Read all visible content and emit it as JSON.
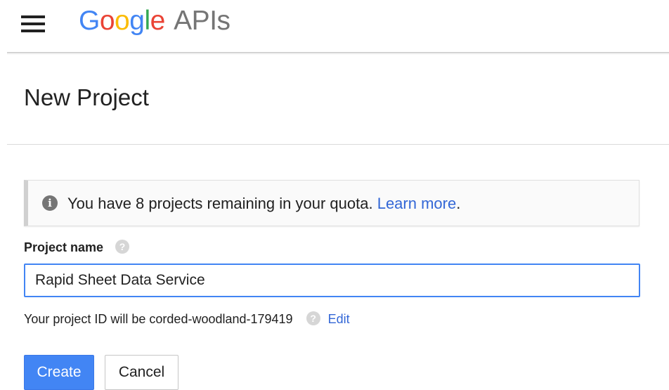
{
  "header": {
    "logo_letters": [
      {
        "char": "G",
        "color": "#4285F4"
      },
      {
        "char": "o",
        "color": "#EA4335"
      },
      {
        "char": "o",
        "color": "#FBBC05"
      },
      {
        "char": "g",
        "color": "#4285F4"
      },
      {
        "char": "l",
        "color": "#34A853"
      },
      {
        "char": "e",
        "color": "#EA4335"
      }
    ],
    "logo_suffix": "APIs",
    "menu_icon": "hamburger-menu-icon"
  },
  "page": {
    "title": "New Project"
  },
  "info": {
    "icon": "info-icon",
    "message": "You have 8 projects remaining in your quota.",
    "link_label": "Learn more",
    "trailing": "."
  },
  "form": {
    "name_label": "Project name",
    "name_value": "Rapid Sheet Data Service",
    "help_icon_glyph": "?",
    "project_id_prefix": "Your project ID will be corded-woodland-179419",
    "edit_label": "Edit"
  },
  "actions": {
    "create_label": "Create",
    "cancel_label": "Cancel"
  },
  "colors": {
    "primary": "#4285F4",
    "link": "#3367D6"
  }
}
